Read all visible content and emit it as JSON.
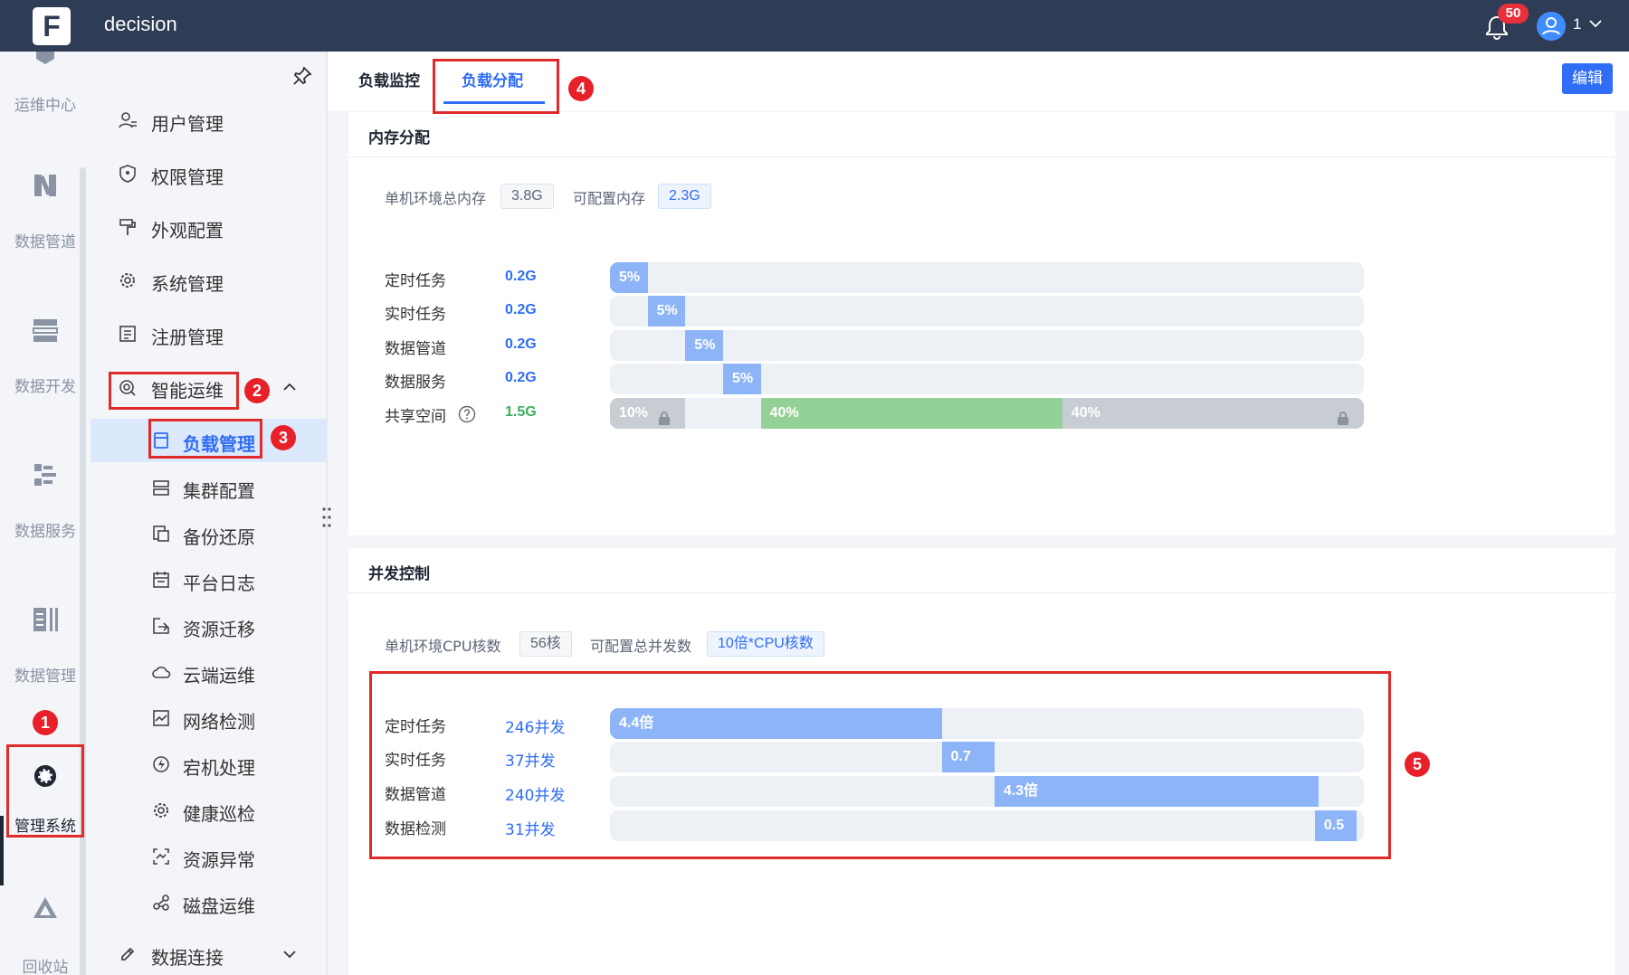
{
  "topbar": {
    "app_name": "decision",
    "notification_count": "50",
    "user_name": "1"
  },
  "rail": {
    "items": [
      {
        "label": "运维中心"
      },
      {
        "label": "数据管道"
      },
      {
        "label": "数据开发"
      },
      {
        "label": "数据服务"
      },
      {
        "label": "数据管理"
      },
      {
        "label": "管理系统"
      },
      {
        "label": "回收站"
      }
    ]
  },
  "menu": {
    "top_items": [
      {
        "label": "用户管理",
        "icon": "user-icon"
      },
      {
        "label": "权限管理",
        "icon": "shield-icon"
      },
      {
        "label": "外观配置",
        "icon": "paint-roller-icon"
      },
      {
        "label": "系统管理",
        "icon": "gear-icon"
      },
      {
        "label": "注册管理",
        "icon": "register-icon"
      },
      {
        "label": "智能运维",
        "icon": "smart-ops-icon"
      }
    ],
    "sub_items": [
      {
        "label": "负载管理",
        "icon": "load-icon",
        "active": true
      },
      {
        "label": "集群配置",
        "icon": "cluster-icon"
      },
      {
        "label": "备份还原",
        "icon": "backup-icon"
      },
      {
        "label": "平台日志",
        "icon": "calendar-icon"
      },
      {
        "label": "资源迁移",
        "icon": "migrate-icon"
      },
      {
        "label": "云端运维",
        "icon": "cloud-icon"
      },
      {
        "label": "网络检测",
        "icon": "network-icon"
      },
      {
        "label": "宕机处理",
        "icon": "lightning-icon"
      },
      {
        "label": "健康巡检",
        "icon": "health-icon"
      },
      {
        "label": "资源异常",
        "icon": "anomaly-icon"
      },
      {
        "label": "磁盘运维",
        "icon": "disk-icon"
      }
    ],
    "bottom_item": {
      "label": "数据连接",
      "icon": "link-icon"
    }
  },
  "tabs": [
    {
      "label": "负载监控"
    },
    {
      "label": "负载分配"
    }
  ],
  "edit_label": "编辑",
  "memory": {
    "title": "内存分配",
    "total_label": "单机环境总内存",
    "total_value": "3.8G",
    "config_label": "可配置内存",
    "config_value": "2.3G",
    "rows": [
      {
        "name": "定时任务",
        "value": "0.2G",
        "segments": [
          {
            "start": 0,
            "pct": 5,
            "label": "5%"
          }
        ]
      },
      {
        "name": "实时任务",
        "value": "0.2G",
        "segments": [
          {
            "start": 5,
            "pct": 5,
            "label": "5%"
          }
        ]
      },
      {
        "name": "数据管道",
        "value": "0.2G",
        "segments": [
          {
            "start": 10,
            "pct": 5,
            "label": "5%"
          }
        ]
      },
      {
        "name": "数据服务",
        "value": "0.2G",
        "segments": [
          {
            "start": 15,
            "pct": 5,
            "label": "5%"
          }
        ]
      }
    ],
    "shared": {
      "name": "共享空间",
      "value": "1.5G",
      "segments": [
        {
          "start": 0,
          "pct": 10,
          "label": "10%",
          "color": "gray",
          "locked": true
        },
        {
          "start": 20,
          "pct": 40,
          "label": "40%",
          "color": "green"
        },
        {
          "start": 60,
          "pct": 40,
          "label": "40%",
          "color": "gray",
          "locked_end": true
        }
      ]
    }
  },
  "concurrency": {
    "title": "并发控制",
    "cpu_label": "单机环境CPU核数",
    "cpu_value": "56核",
    "total_label": "可配置总并发数",
    "total_value": "10倍*CPU核数",
    "rows": [
      {
        "name": "定时任务",
        "value": "246并发",
        "start": 0,
        "pct": 44,
        "label": "4.4倍"
      },
      {
        "name": "实时任务",
        "value": "37并发",
        "start": 44,
        "pct": 7,
        "label": "0.7"
      },
      {
        "name": "数据管道",
        "value": "240并发",
        "start": 51,
        "pct": 43,
        "label": "4.3倍"
      },
      {
        "name": "数据检测",
        "value": "31并发",
        "start": 93.5,
        "pct": 5.5,
        "label": "0.5"
      }
    ]
  },
  "annotations": [
    "1",
    "2",
    "3",
    "4",
    "5"
  ],
  "colors": {
    "topbar": "#2f3c56",
    "accent": "#2f6df6",
    "bar_blue": "#8db4f6",
    "bar_green": "#94d196",
    "bar_gray": "#c8ccd3",
    "highlight": "#e02b2b"
  }
}
